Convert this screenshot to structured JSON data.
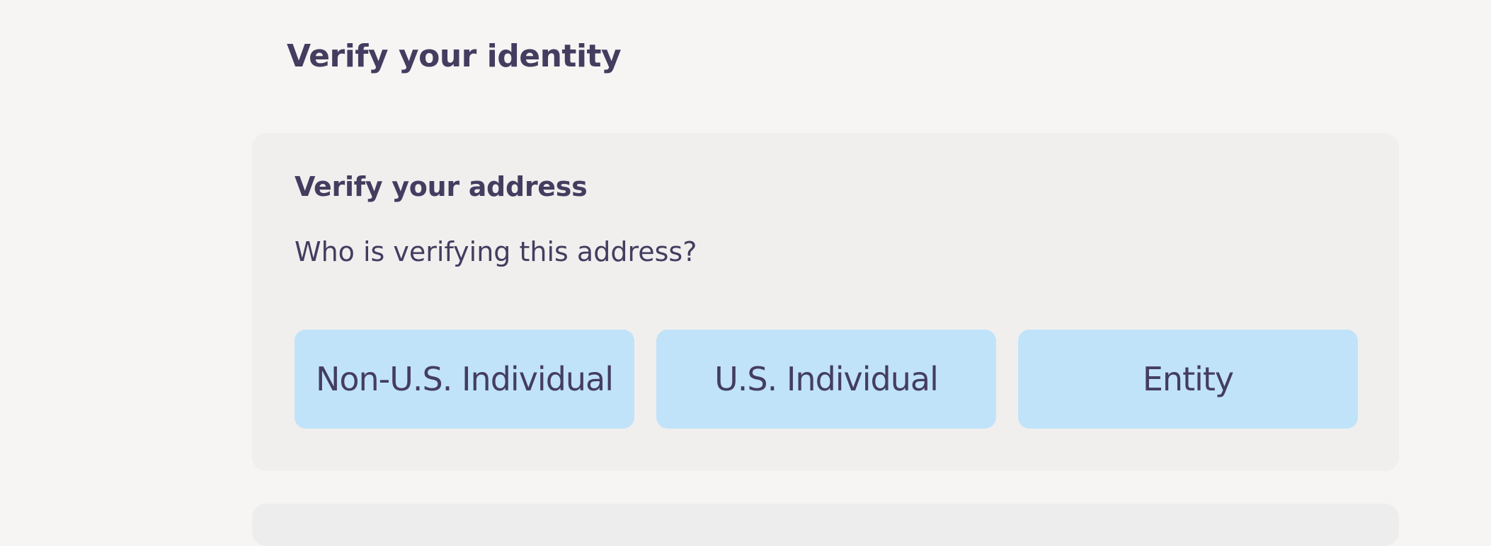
{
  "page": {
    "title": "Verify your identity"
  },
  "address_card": {
    "title": "Verify your address",
    "question": "Who is verifying this address?",
    "options": [
      {
        "label": "Non-U.S. Individual"
      },
      {
        "label": "U.S. Individual"
      },
      {
        "label": "Entity"
      }
    ]
  },
  "colors": {
    "background": "#f6f5f4",
    "card": "#f0efee",
    "option_button": "#c0e3f9",
    "text": "#443d5f"
  }
}
